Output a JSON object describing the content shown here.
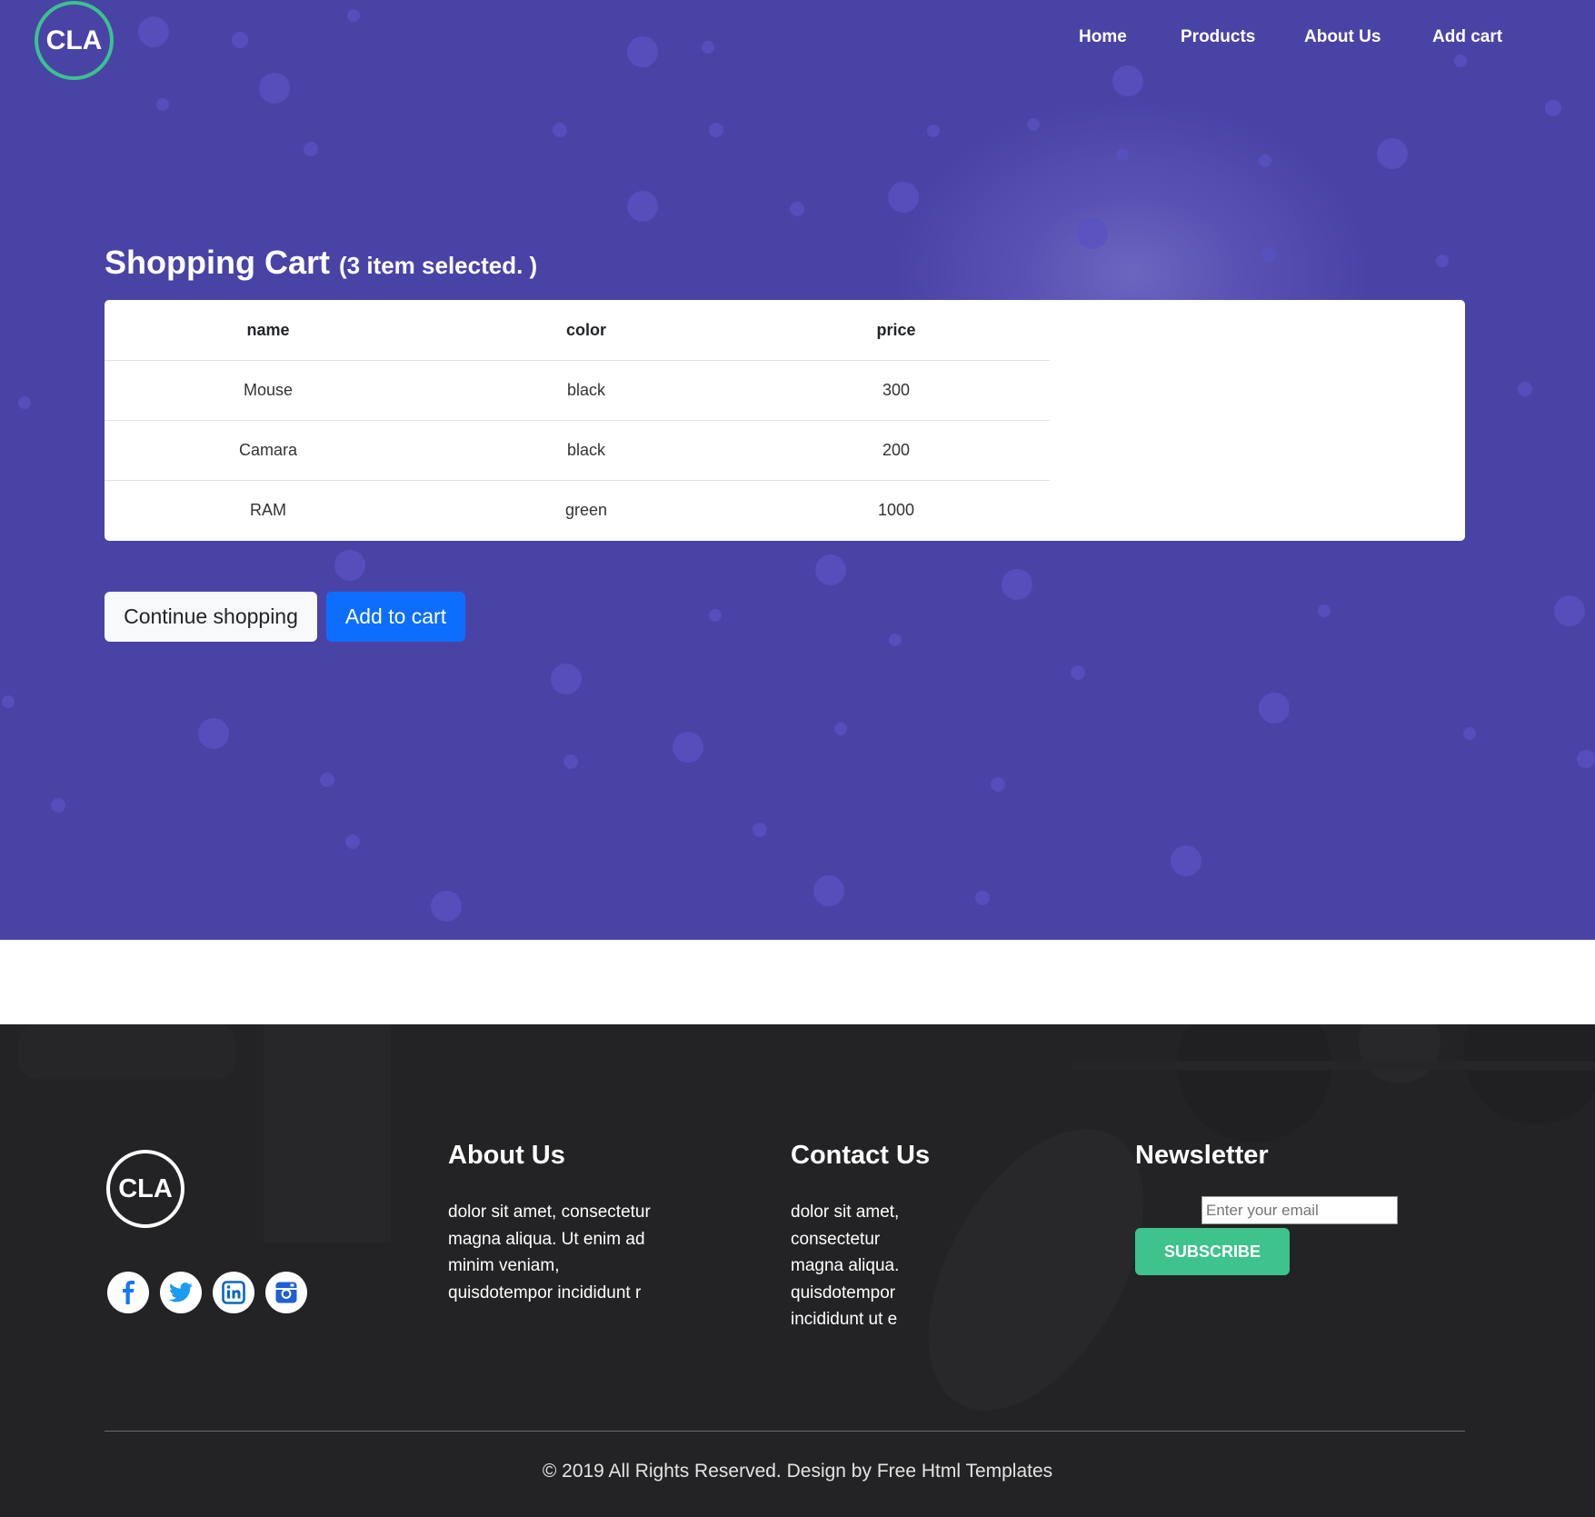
{
  "brand": {
    "logo_text": "CLA"
  },
  "nav": {
    "items": [
      {
        "label": "Home"
      },
      {
        "label": "Products"
      },
      {
        "label": "About Us"
      },
      {
        "label": "Add cart"
      }
    ]
  },
  "cart": {
    "title": "Shopping Cart",
    "selected_note": "(3 item selected. )",
    "columns": [
      "name",
      "color",
      "price"
    ],
    "rows": [
      {
        "name": "Mouse",
        "color": "black",
        "price": "300"
      },
      {
        "name": "Camara",
        "color": "black",
        "price": "200"
      },
      {
        "name": "RAM",
        "color": "green",
        "price": "1000"
      }
    ],
    "continue_label": "Continue shopping",
    "add_label": "Add to cart"
  },
  "footer": {
    "logo_text": "CLA",
    "social": [
      {
        "icon": "facebook-icon"
      },
      {
        "icon": "twitter-icon"
      },
      {
        "icon": "linkedin-icon"
      },
      {
        "icon": "instagram-icon"
      }
    ],
    "about": {
      "heading": "About Us",
      "lines": [
        "dolor sit amet, consectetur",
        "magna aliqua. Ut enim ad",
        "minim veniam,",
        "quisdotempor incididunt r"
      ]
    },
    "contact": {
      "heading": "Contact Us",
      "lines": [
        "dolor sit amet,",
        "consectetur",
        "magna aliqua.",
        "quisdotempor",
        "incididunt ut e"
      ]
    },
    "newsletter": {
      "heading": "Newsletter",
      "email_placeholder": "Enter your email",
      "subscribe_label": "SUBSCRIBE"
    },
    "copyright": "© 2019 All Rights Reserved. Design by Free Html Templates"
  },
  "colors": {
    "hero_bg": "#4a43a6",
    "footer_bg": "#232325",
    "accent_green": "#3ec38c",
    "primary_blue": "#0d6efd",
    "facebook": "#1877f2",
    "twitter": "#1d9bf0",
    "linkedin": "#0a66c2",
    "instagram": "#1f5fd1"
  }
}
